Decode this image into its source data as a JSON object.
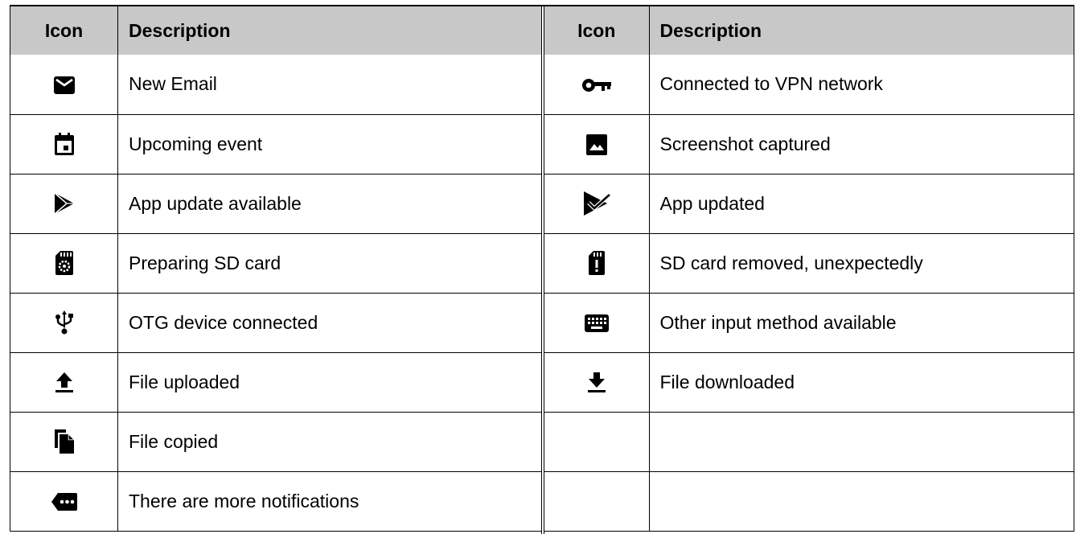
{
  "left": {
    "header": {
      "icon": "Icon",
      "description": "Description"
    },
    "rows": [
      {
        "icon": "email-icon",
        "description": "New Email"
      },
      {
        "icon": "calendar-icon",
        "description": "Upcoming event"
      },
      {
        "icon": "play-store-icon",
        "description": "App update available"
      },
      {
        "icon": "sd-card-settings-icon",
        "description": "Preparing SD card"
      },
      {
        "icon": "usb-icon",
        "description": "OTG device connected"
      },
      {
        "icon": "upload-icon",
        "description": "File uploaded"
      },
      {
        "icon": "file-copy-icon",
        "description": "File copied"
      },
      {
        "icon": "more-notifications-icon",
        "description": "There are more notifications"
      }
    ]
  },
  "right": {
    "header": {
      "icon": "Icon",
      "description": "Description"
    },
    "rows": [
      {
        "icon": "vpn-key-icon",
        "description": "Connected to VPN network"
      },
      {
        "icon": "image-icon",
        "description": "Screenshot captured"
      },
      {
        "icon": "play-store-check-icon",
        "description": "App updated"
      },
      {
        "icon": "sd-card-alert-icon",
        "description": "SD card removed, unexpectedly"
      },
      {
        "icon": "keyboard-icon",
        "description": "Other input method available"
      },
      {
        "icon": "download-icon",
        "description": "File downloaded"
      },
      {
        "icon": "",
        "description": ""
      },
      {
        "icon": "",
        "description": ""
      }
    ]
  }
}
